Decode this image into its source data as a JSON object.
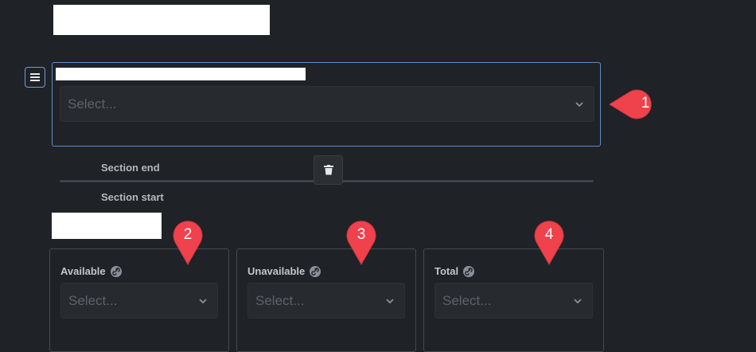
{
  "form": {
    "select_placeholder": "Select...",
    "section_end_label": "Section end",
    "section_start_label": "Section start"
  },
  "fields": [
    {
      "label": "Available",
      "placeholder": "Select..."
    },
    {
      "label": "Unavailable",
      "placeholder": "Select..."
    },
    {
      "label": "Total",
      "placeholder": "Select..."
    }
  ],
  "callouts": [
    "1",
    "2",
    "3",
    "4"
  ],
  "icons": {
    "menu": "hamburger-icon",
    "select_arrow": "chevron-down-icon",
    "delete": "trash-icon",
    "link": "link-icon"
  },
  "colors": {
    "background": "#1f2227",
    "panel_border": "#5f8ec6",
    "callout": "#f0424c",
    "input_bg": "#272b30"
  }
}
